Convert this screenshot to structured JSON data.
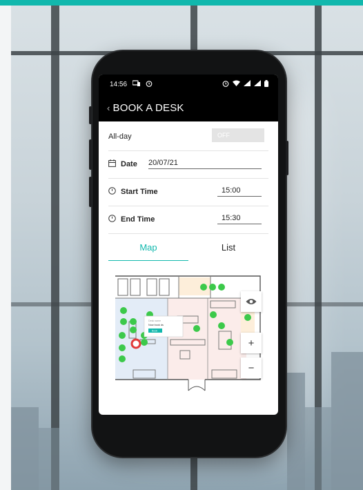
{
  "status_bar": {
    "time": "14:56"
  },
  "app_bar": {
    "back_label": "‹",
    "title": "BOOK A DESK"
  },
  "form": {
    "all_day": {
      "label": "All-day",
      "toggle_state": "OFF"
    },
    "date": {
      "label": "Date",
      "value": "20/07/21"
    },
    "start_time": {
      "label": "Start Time",
      "value": "15:00"
    },
    "end_time": {
      "label": "End Time",
      "value": "15:30"
    }
  },
  "tabs": [
    {
      "label": "Map",
      "active": true
    },
    {
      "label": "List",
      "active": false
    }
  ],
  "map": {
    "popup_title": "Desk name",
    "popup_text": "Now book ds",
    "popup_button": "Book",
    "zoom_in": "+",
    "zoom_out": "−"
  },
  "colors": {
    "accent": "#11b8ad",
    "available_desk": "#3cc94a",
    "selected_desk": "#e23a3a"
  }
}
